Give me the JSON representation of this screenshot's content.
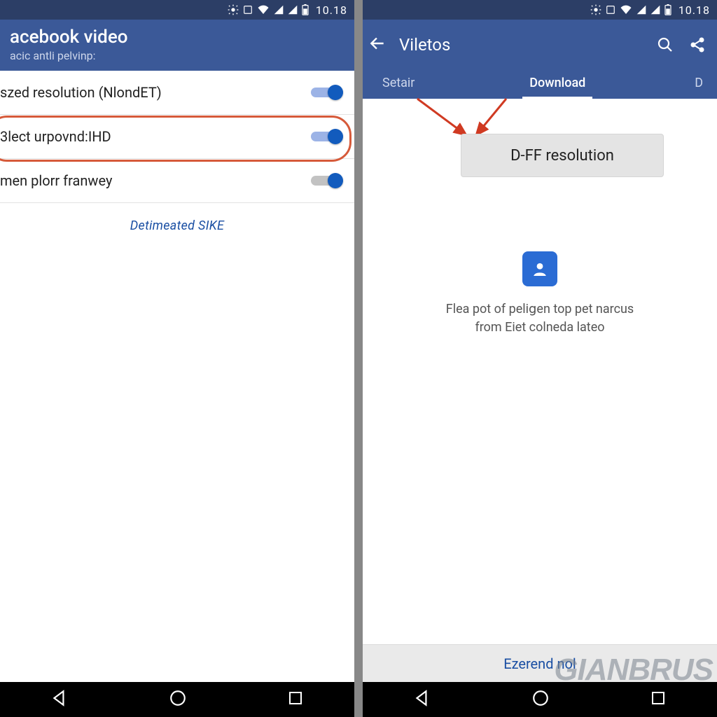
{
  "status": {
    "time": "10.18",
    "icons": [
      "brightness-icon",
      "nfc-icon",
      "wifi-icon",
      "signal1-icon",
      "signal2-icon",
      "battery-icon"
    ]
  },
  "left": {
    "appbar": {
      "title": "acebook video",
      "subtitle": "acic antli pelvinp:"
    },
    "rows": [
      {
        "label": "szed resolution (NlondET)",
        "state": "on"
      },
      {
        "label": "3lect urpovnd:IHD",
        "state": "on",
        "highlighted": true
      },
      {
        "label": "men plorr franwey",
        "state": "mid"
      }
    ],
    "footer_link": "Detimeated SIKE"
  },
  "right": {
    "appbar": {
      "title": "Viletos"
    },
    "tabs": [
      {
        "label": "Setair",
        "active": false
      },
      {
        "label": "Download",
        "active": true
      },
      {
        "label": "D",
        "active": false
      }
    ],
    "resolution_button": "D-FF resolution",
    "empty_text_line1": "Flea pot of peliցen top pet narcus",
    "empty_text_line2": "from Eiet colneda lateo",
    "bottom_action": "Ezerend nol"
  },
  "watermark": "GIANBRUS"
}
